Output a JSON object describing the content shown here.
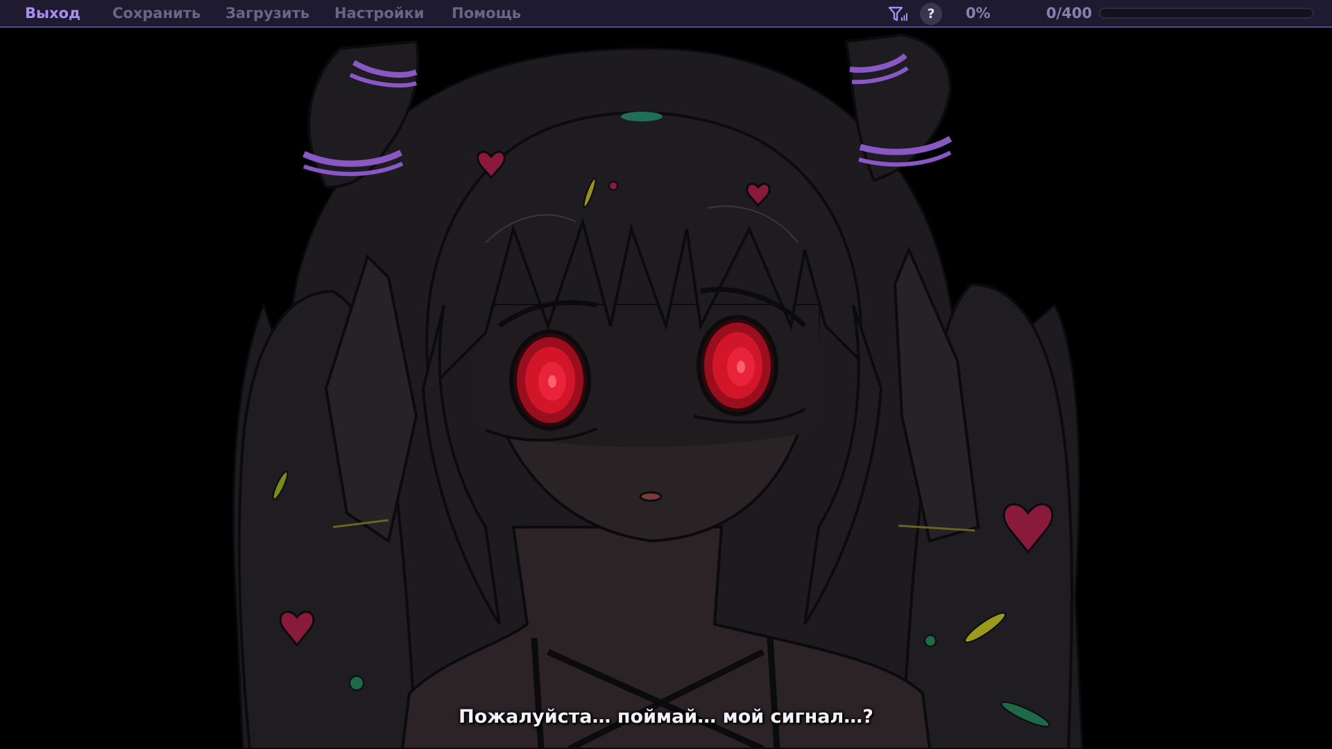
{
  "menu": {
    "items": [
      {
        "label": "Выход",
        "active": true
      },
      {
        "label": "Сохранить",
        "active": false
      },
      {
        "label": "Загрузить",
        "active": false
      },
      {
        "label": "Настройки",
        "active": false
      },
      {
        "label": "Помощь",
        "active": false
      }
    ]
  },
  "status": {
    "filter_icon": "signal-filter-icon",
    "help_label": "?",
    "percent_text": "0%",
    "counter_text": "0/400",
    "progress_fraction": 0
  },
  "dialogue": {
    "text": "Пожалуйста… поймай… мой сигнал…?"
  },
  "colors": {
    "accent": "#a88ff0",
    "menu_inactive": "#6c6486",
    "bar_bg": "#1e1a30",
    "eye_red": "#d3152a"
  }
}
